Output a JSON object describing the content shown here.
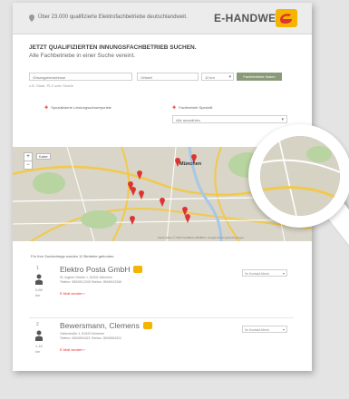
{
  "header": {
    "note": "Über 23.000 qualifizierte Elektrofachbetriebe deutschlandweit.",
    "logo_text": "E-HANDWERK"
  },
  "search": {
    "title": "JETZT QUALIFIZIERTEN INNUNGSFACHBETRIEB SUCHEN.",
    "subtitle": "Alle Fachbetriebe in einer Suche vereint.",
    "location_placeholder": "Ortsangabe/adresse",
    "location_hint": "z.B. Stadt, PLZ oder Straße",
    "place_placeholder": "Ortsteil",
    "radius_value": "10 km",
    "search_button": "Fachbetriebe finden"
  },
  "filters": {
    "special_label": "Spezialisierte Leistungsschwerpunkte",
    "service_label": "Fachbetrieb Spezielll",
    "service_value": "Alle auswählen"
  },
  "map": {
    "zoom_in": "+",
    "zoom_out": "−",
    "type_button": "Karte",
    "city_label": "München",
    "credit": "Kartendaten © 2013 GeoBasis-DE/BKG, Google   Nutzungsbedingungen"
  },
  "results": {
    "count_label": "Für Ihre Suchanfrage wurden 10 Betriebe gefunden.",
    "items": [
      {
        "rank": "1",
        "distance": "0,66",
        "distance_unit": "km",
        "name": "Elektro Posta GmbH",
        "address": "St.-Ingbert-Straße 1, 81541 München",
        "phone": "Telefon: 089/6912345     Telefax: 089/6912346",
        "elink": "E-Mail senden",
        "select": "Ihr Kontakt-Menü"
      },
      {
        "rank": "2",
        "distance": "1,18",
        "distance_unit": "km",
        "name": "Bewersmann, Clemens",
        "address": "Ostenstraße 4, 81543 München",
        "phone": "Telefon: 089/6554321     Telefax: 089/6554322",
        "elink": "E-Mail senden",
        "select": "Ihr Kontakt-Menü"
      }
    ]
  },
  "colors": {
    "accent_red": "#d33333",
    "badge_yellow": "#f4b400",
    "search_green": "#8a9a78"
  }
}
